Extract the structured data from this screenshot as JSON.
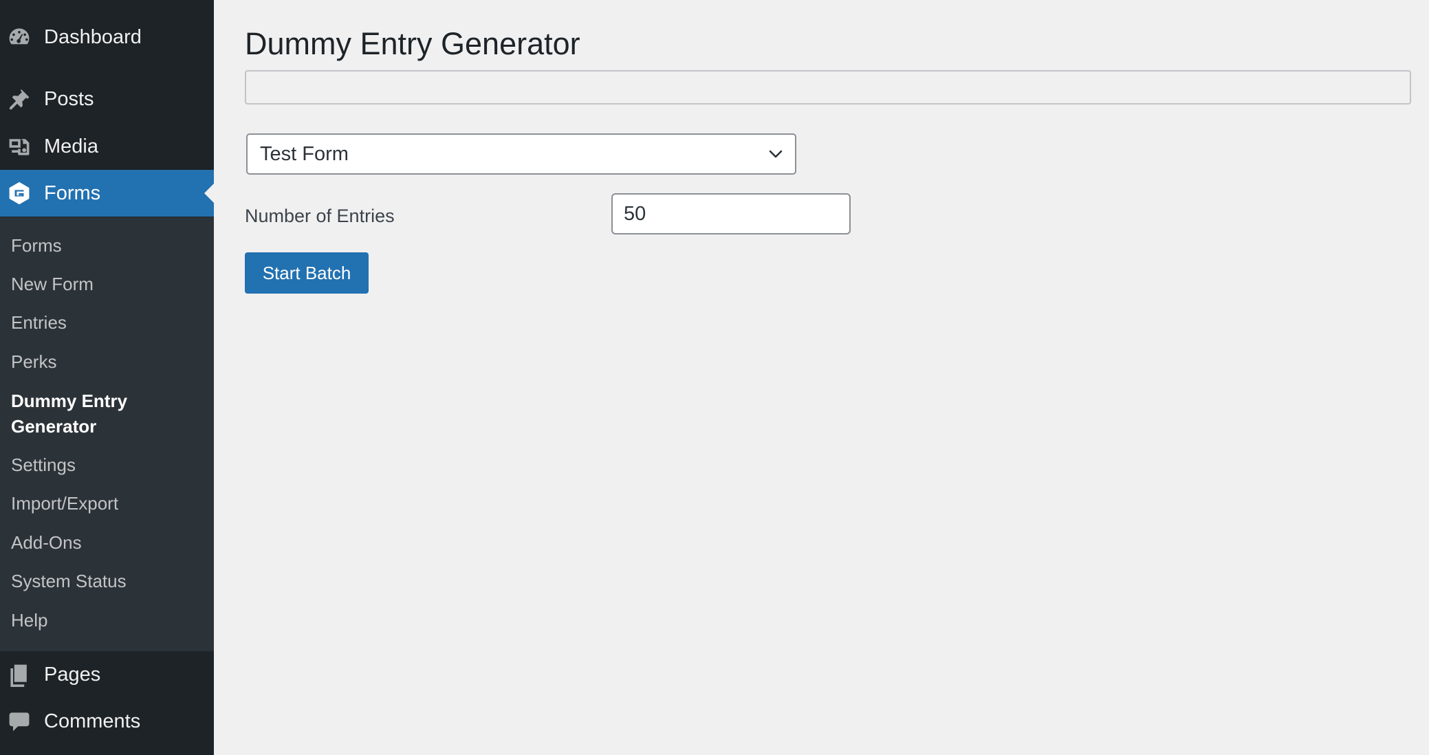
{
  "sidebar": {
    "top_items": [
      {
        "label": "Dashboard",
        "icon": "dashboard-icon"
      },
      {
        "label": "Posts",
        "icon": "pushpin-icon"
      },
      {
        "label": "Media",
        "icon": "media-icon"
      },
      {
        "label": "Forms",
        "icon": "gravity-forms-icon"
      }
    ],
    "submenu": [
      {
        "label": "Forms"
      },
      {
        "label": "New Form"
      },
      {
        "label": "Entries"
      },
      {
        "label": "Perks"
      },
      {
        "label": "Dummy Entry Generator"
      },
      {
        "label": "Settings"
      },
      {
        "label": "Import/Export"
      },
      {
        "label": "Add-Ons"
      },
      {
        "label": "System Status"
      },
      {
        "label": "Help"
      }
    ],
    "bottom_items": [
      {
        "label": "Pages",
        "icon": "pages-icon"
      },
      {
        "label": "Comments",
        "icon": "comment-icon"
      }
    ],
    "accent_color": "#2271b1"
  },
  "main": {
    "title": "Dummy Entry Generator",
    "form_select": {
      "selected": "Test Form"
    },
    "entries": {
      "label": "Number of Entries",
      "value": "50"
    },
    "start_button": {
      "label": "Start Batch"
    }
  }
}
